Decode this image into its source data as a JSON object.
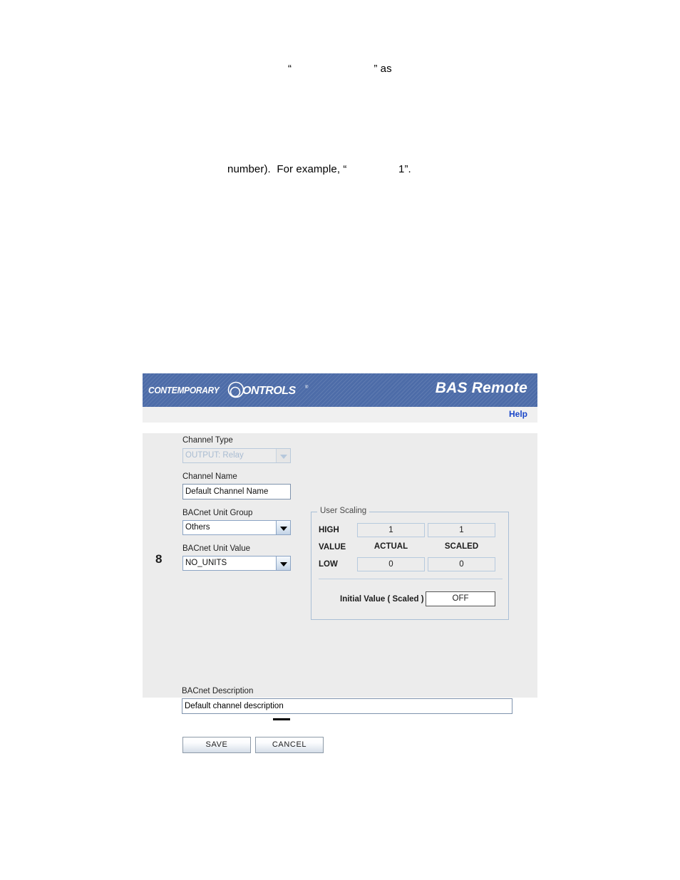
{
  "document": {
    "line_1": "“                           ” as",
    "line_2": "number).  For example, “                 1”.",
    "rule": ""
  },
  "figure": {
    "banner": {
      "brand_word": "CONTEMPORARY",
      "brand_mark": "CONTROLS",
      "title": "BAS Remote",
      "background_color": "#4d6ca8"
    },
    "help_bar": {
      "help_label": "Help",
      "link_color": "#1a46c8"
    },
    "panel": {
      "step_number": "8",
      "fields": {
        "channel_type": {
          "label": "Channel Type",
          "value": "OUTPUT: Relay",
          "disabled": true
        },
        "channel_name": {
          "label": "Channel Name",
          "value": "Default Channel Name"
        },
        "bacnet_unit_group": {
          "label": "BACnet Unit Group",
          "value": "Others"
        },
        "bacnet_unit_value": {
          "label": "BACnet Unit Value",
          "value": "NO_UNITS"
        },
        "bacnet_description": {
          "label": "BACnet Description",
          "value": "Default channel description"
        }
      },
      "user_scaling": {
        "legend": "User Scaling",
        "row_high": "HIGH",
        "row_value": "VALUE",
        "row_low": "LOW",
        "col_actual": "ACTUAL",
        "col_scaled": "SCALED",
        "high_actual": "1",
        "high_scaled": "1",
        "low_actual": "0",
        "low_scaled": "0",
        "initial_label": "Initial Value ( Scaled )",
        "initial_value": "OFF"
      },
      "buttons": {
        "save": "SAVE",
        "cancel": "CANCEL"
      }
    }
  }
}
